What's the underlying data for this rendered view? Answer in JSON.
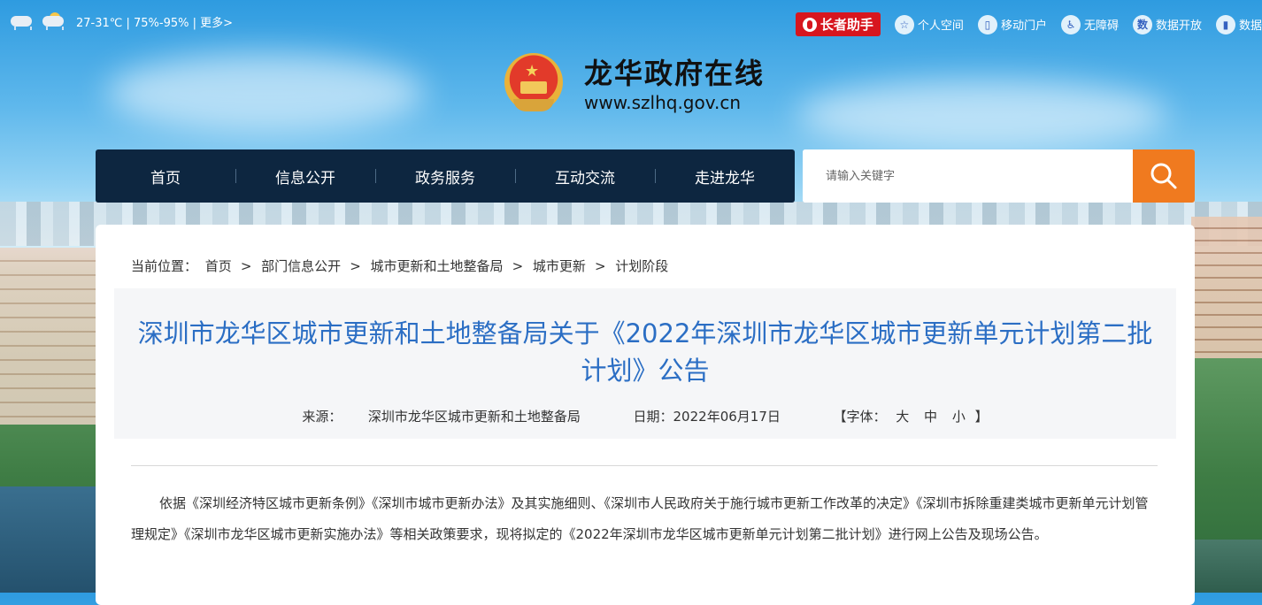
{
  "topbar": {
    "weather_text": "27-31℃ | 75%-95% | 更多>",
    "elder_label": "长者助手",
    "tools": [
      {
        "icon": "star-icon",
        "label": "个人空间"
      },
      {
        "icon": "mobile-icon",
        "label": "移动门户"
      },
      {
        "icon": "accessibility-icon",
        "label": "无障碍"
      },
      {
        "icon": "data-icon",
        "label": "数据开放"
      },
      {
        "icon": "chart-icon",
        "label": "数据"
      }
    ]
  },
  "logo": {
    "title": "龙华政府在线",
    "url": "www.szlhq.gov.cn"
  },
  "nav": {
    "items": [
      "首页",
      "信息公开",
      "政务服务",
      "互动交流",
      "走进龙华"
    ]
  },
  "search": {
    "placeholder": "请输入关键字"
  },
  "breadcrumb": {
    "prefix": "当前位置：",
    "items": [
      "首页",
      "部门信息公开",
      "城市更新和土地整备局",
      "城市更新",
      "计划阶段"
    ]
  },
  "article": {
    "title": "深圳市龙华区城市更新和土地整备局关于《2022年深圳市龙华区城市更新单元计划第二批计划》公告",
    "source_label": "来源：",
    "source": "深圳市龙华区城市更新和土地整备局",
    "date_label": "日期：",
    "date": "2022年06月17日",
    "font_label": "【字体：",
    "font_large": "大",
    "font_medium": "中",
    "font_small": "小",
    "font_close": "】",
    "body": "依据《深圳经济特区城市更新条例》《深圳市城市更新办法》及其实施细则、《深圳市人民政府关于施行城市更新工作改革的决定》《深圳市拆除重建类城市更新单元计划管理规定》《深圳市龙华区城市更新实施办法》等相关政策要求，现将拟定的《2022年深圳市龙华区城市更新单元计划第二批计划》进行网上公告及现场公告。"
  },
  "colors": {
    "nav_bg": "#0d2640",
    "search_btn": "#f07a1f",
    "title_blue": "#2b6ec4",
    "elder_red": "#d7161e"
  }
}
